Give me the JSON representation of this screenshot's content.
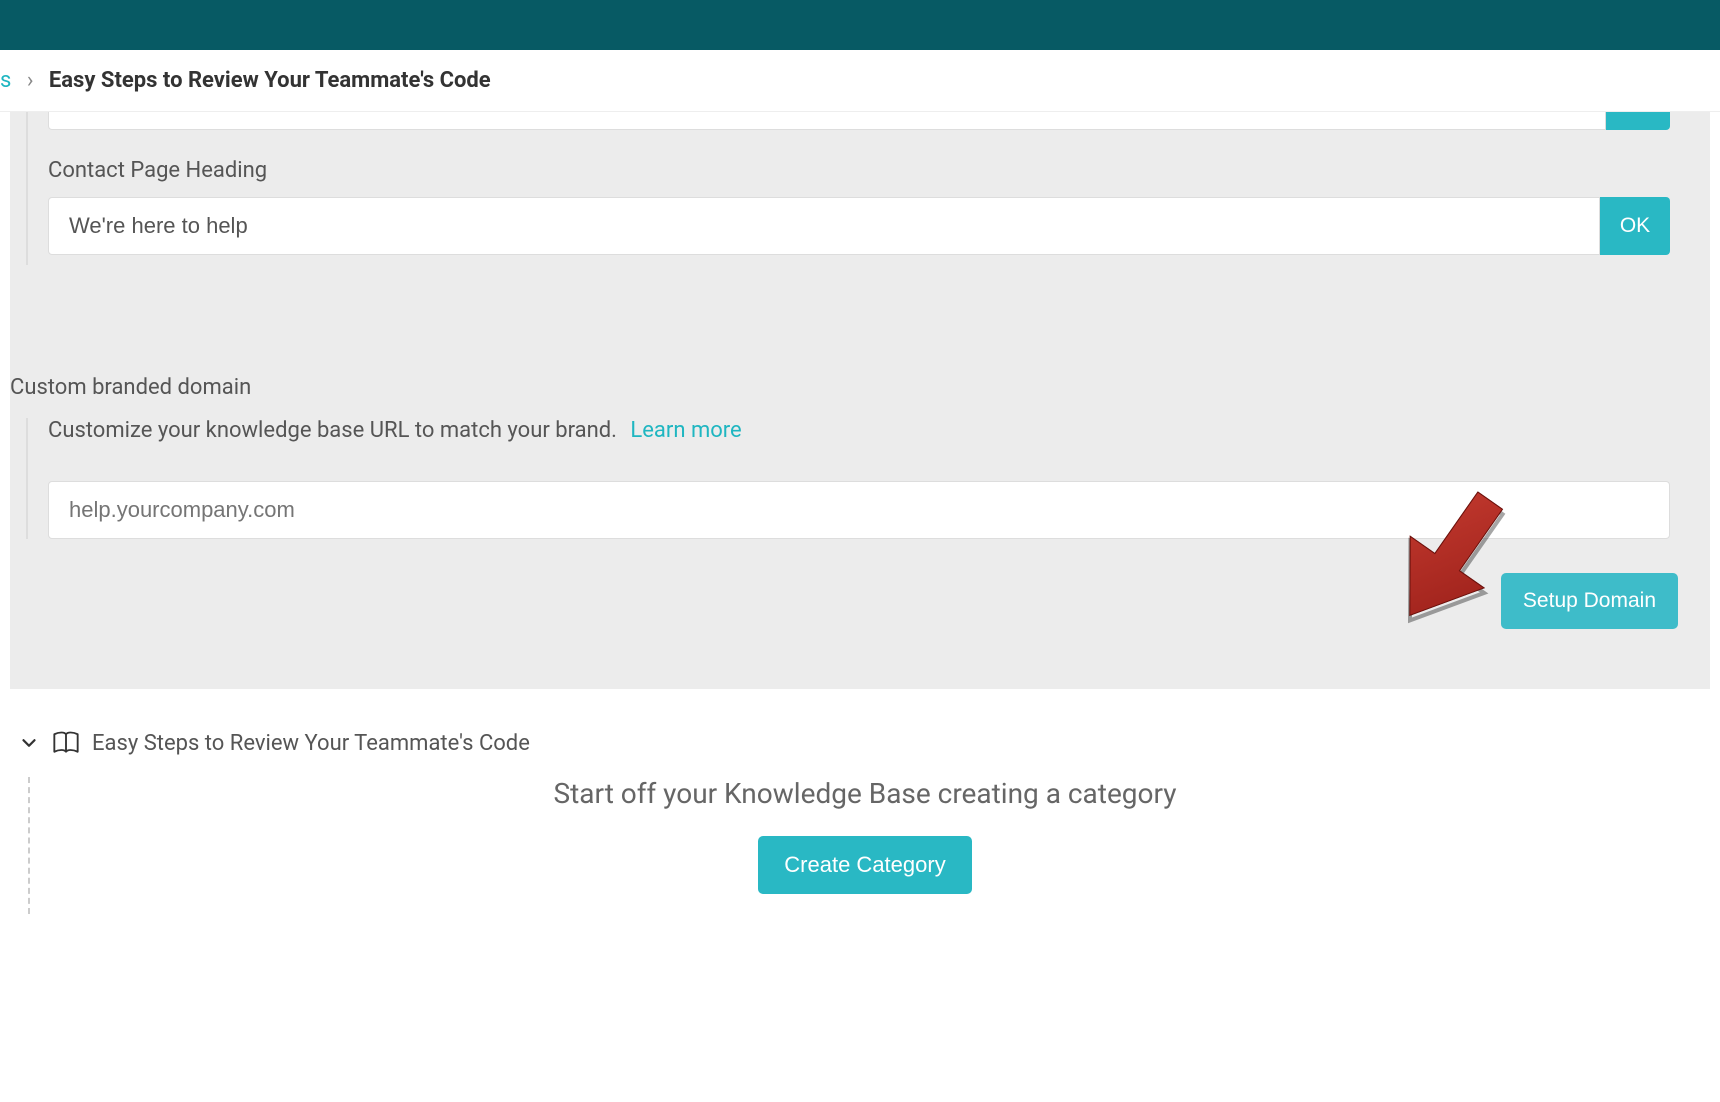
{
  "breadcrumb": {
    "prev_fragment": "s",
    "separator": "›",
    "current": "Easy Steps to Review Your Teammate's Code"
  },
  "contact_heading": {
    "label": "Contact Page Heading",
    "value": "We're here to help",
    "ok_label": "OK"
  },
  "custom_domain": {
    "title": "Custom branded domain",
    "description": "Customize your knowledge base URL to match your brand.",
    "learn_more_label": "Learn more",
    "placeholder": "help.yourcompany.com",
    "setup_button_label": "Setup Domain"
  },
  "kb_section": {
    "title": "Easy Steps to Review Your Teammate's Code",
    "subtitle": "Start off your Knowledge Base creating a category",
    "create_button_label": "Create Category"
  }
}
